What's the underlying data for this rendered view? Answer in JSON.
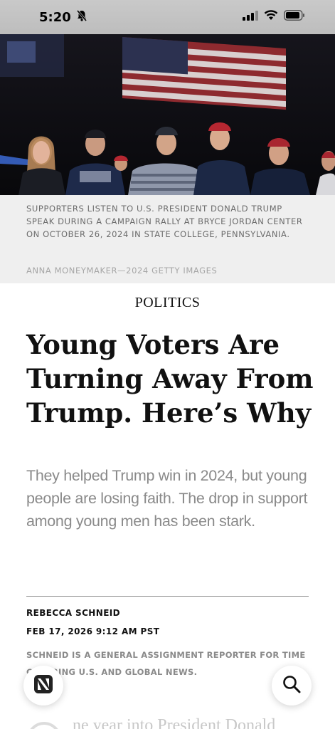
{
  "status_bar": {
    "time": "5:20",
    "icons": [
      "bell-slash-icon",
      "cellular-signal-icon",
      "wifi-icon",
      "battery-icon"
    ]
  },
  "hero_image": {
    "description_icon": "photo"
  },
  "caption": {
    "text": "Supporters listen to U.S. President Donald Trump speak during a campaign rally at Bryce Jordan Center on October 26, 2024 in State College, Pennsylvania.",
    "credit": "ANNA MONEYMAKER—2024 GETTY IMAGES"
  },
  "article": {
    "section": "POLITICS",
    "headline": "Young Voters Are Turning Away From Trump. Here’s Why",
    "dek": "They helped Trump win in 2024, but young people are losing faith. The drop in support among young men has been stark.",
    "author": "REBECCA SCHNEID",
    "date": "FEB 17, 2026 9:12 AM PST",
    "bio": "Schneid is a general assignment reporter for TIME covering U.S. and global news.",
    "body_start": "ne year into President Donald"
  },
  "floating_buttons": {
    "news": "news-icon",
    "search": "search-icon"
  },
  "colors": {
    "caption_bg": "#efefef",
    "caption_text": "#6b6b6b",
    "dek_text": "#8a8a8a",
    "headline_text": "#111111"
  }
}
